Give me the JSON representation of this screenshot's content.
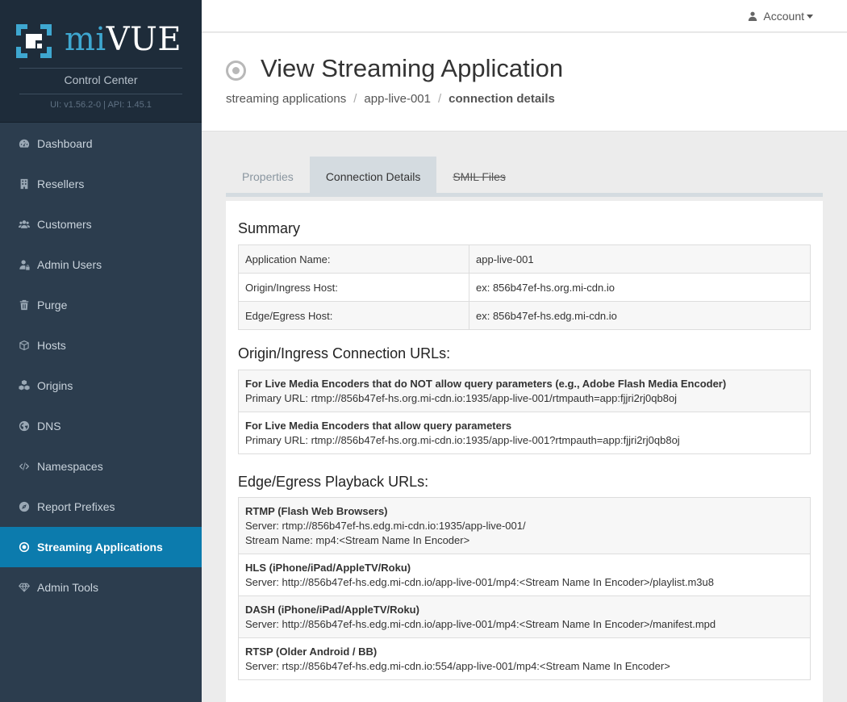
{
  "brand": {
    "prefix": "mi",
    "name": "VUE",
    "subtitle": "Control Center",
    "version": "UI: v1.56.2-0  |  API: 1.45.1"
  },
  "nav": [
    {
      "label": "Dashboard",
      "icon": "dashboard-icon"
    },
    {
      "label": "Resellers",
      "icon": "building-icon"
    },
    {
      "label": "Customers",
      "icon": "users-icon"
    },
    {
      "label": "Admin Users",
      "icon": "user-lock-icon"
    },
    {
      "label": "Purge",
      "icon": "trash-icon"
    },
    {
      "label": "Hosts",
      "icon": "cube-icon"
    },
    {
      "label": "Origins",
      "icon": "cubes-icon"
    },
    {
      "label": "DNS",
      "icon": "globe-icon"
    },
    {
      "label": "Namespaces",
      "icon": "code-icon"
    },
    {
      "label": "Report Prefixes",
      "icon": "compass-icon"
    },
    {
      "label": "Streaming Applications",
      "icon": "dot-circle-icon",
      "active": true
    },
    {
      "label": "Admin Tools",
      "icon": "diamond-icon"
    }
  ],
  "account": {
    "label": "Account"
  },
  "header": {
    "title": "View Streaming Application",
    "breadcrumb": [
      "streaming applications",
      "app-live-001",
      "connection details"
    ]
  },
  "tabs": [
    {
      "label": "Properties"
    },
    {
      "label": "Connection Details",
      "active": true
    },
    {
      "label": "SMIL Files"
    }
  ],
  "summary": {
    "title": "Summary",
    "rows": [
      {
        "key": "Application Name:",
        "value": "app-live-001"
      },
      {
        "key": "Origin/Ingress Host:",
        "value": "ex: 856b47ef-hs.org.mi-cdn.io"
      },
      {
        "key": "Edge/Egress Host:",
        "value": "ex: 856b47ef-hs.edg.mi-cdn.io"
      }
    ]
  },
  "ingress": {
    "title": "Origin/Ingress Connection URLs:",
    "rows": [
      {
        "label": "For Live Media Encoders that do NOT allow query parameters (e.g., Adobe Flash Media Encoder)",
        "lines": [
          "Primary URL: rtmp://856b47ef-hs.org.mi-cdn.io:1935/app-live-001/rtmpauth=app:fjjri2rj0qb8oj"
        ]
      },
      {
        "label": "For Live Media Encoders that allow query parameters",
        "lines": [
          "Primary URL: rtmp://856b47ef-hs.org.mi-cdn.io:1935/app-live-001?rtmpauth=app:fjjri2rj0qb8oj"
        ]
      }
    ]
  },
  "egress": {
    "title": "Edge/Egress Playback URLs:",
    "rows": [
      {
        "label": "RTMP (Flash Web Browsers)",
        "lines": [
          "Server: rtmp://856b47ef-hs.edg.mi-cdn.io:1935/app-live-001/",
          "Stream Name: mp4:<Stream Name In Encoder>"
        ]
      },
      {
        "label": "HLS (iPhone/iPad/AppleTV/Roku)",
        "lines": [
          "Server: http://856b47ef-hs.edg.mi-cdn.io/app-live-001/mp4:<Stream Name In Encoder>/playlist.m3u8"
        ]
      },
      {
        "label": "DASH (iPhone/iPad/AppleTV/Roku)",
        "lines": [
          "Server: http://856b47ef-hs.edg.mi-cdn.io/app-live-001/mp4:<Stream Name In Encoder>/manifest.mpd"
        ]
      },
      {
        "label": "RTSP (Older Android / BB)",
        "lines": [
          "Server: rtsp://856b47ef-hs.edg.mi-cdn.io:554/app-live-001/mp4:<Stream Name In Encoder>"
        ]
      }
    ]
  },
  "colors": {
    "sidebar": "#2c3d4e",
    "sidebar_head": "#1e2c3a",
    "active_nav": "#0c7bad",
    "brand_accent": "#3ea7d0"
  }
}
